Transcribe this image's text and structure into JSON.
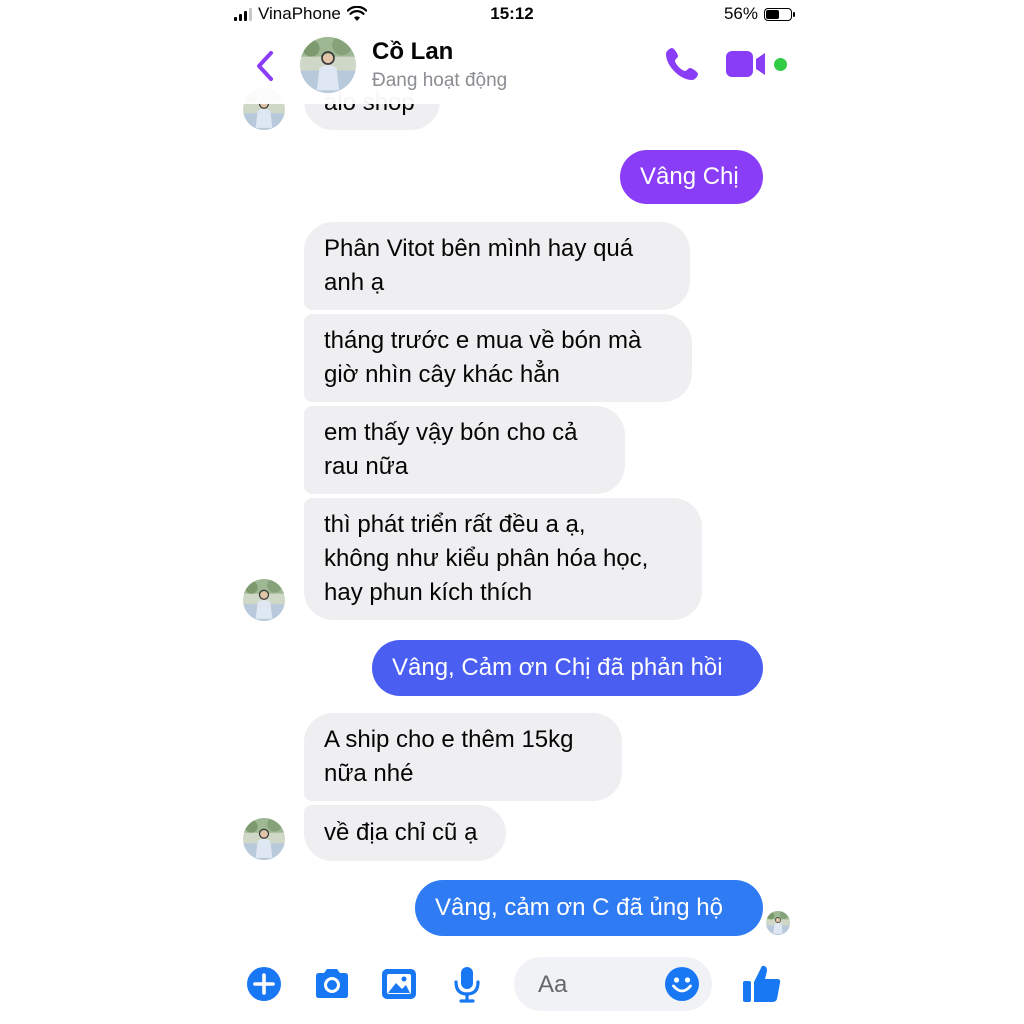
{
  "status_bar": {
    "carrier": "VinaPhone",
    "time": "15:12",
    "battery_percent": "56%",
    "battery_level": 0.56
  },
  "header": {
    "contact_name": "Cồ Lan",
    "contact_status": "Đang hoạt động",
    "accent_color": "#8a3df6",
    "online_color": "#31cc46"
  },
  "messages": [
    {
      "from": "contact",
      "text": "alo shop"
    },
    {
      "from": "me",
      "text": "Vâng Chị"
    },
    {
      "from": "contact",
      "text": "Phân Vitot bên mình hay quá\nanh ạ"
    },
    {
      "from": "contact",
      "text": "tháng trước e mua về bón mà\ngiờ nhìn cây khác hẳn"
    },
    {
      "from": "contact",
      "text": "em thấy vậy bón cho cả\nrau nữa"
    },
    {
      "from": "contact",
      "text": "thì phát triển rất đều a ạ,\nkhông như kiểu phân hóa học,\nhay phun kích thích"
    },
    {
      "from": "me",
      "text": "Vâng, Cảm ơn Chị đã phản hồi"
    },
    {
      "from": "contact",
      "text": "A ship cho e thêm 15kg\nnữa nhé"
    },
    {
      "from": "contact",
      "text": "về địa chỉ cũ ạ"
    },
    {
      "from": "me",
      "text": "Vâng, cảm ơn C đã ủng hộ"
    }
  ],
  "composer": {
    "placeholder": "Aa",
    "icons": [
      "plus-icon",
      "camera-icon",
      "gallery-icon",
      "microphone-icon",
      "emoji-icon",
      "thumbs-up-icon"
    ],
    "icon_color": "#1877f2"
  },
  "bubble_colors": {
    "incoming": "#efeff1",
    "outgoing_top": "#8a3df6",
    "outgoing_middle": "#4a5ef2",
    "outgoing_bottom": "#2f7bf3"
  }
}
